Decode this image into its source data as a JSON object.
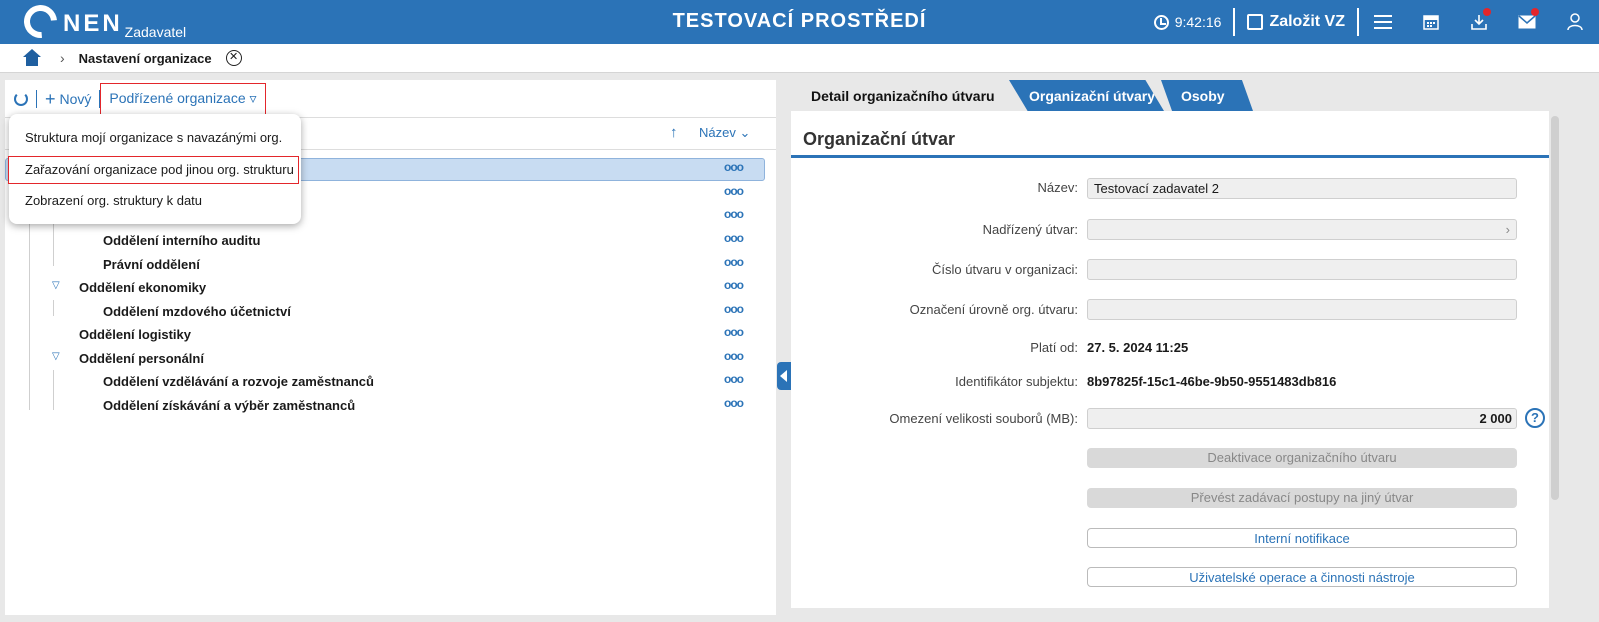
{
  "topbar": {
    "logo_text": "NEN",
    "logo_sub": "Zadavatel",
    "env_title": "TESTOVACÍ PROSTŘEDÍ",
    "time": "9:42:16",
    "create_label": "Založit VZ"
  },
  "breadcrumb": {
    "current": "Nastavení organizace",
    "close_glyph": "✕"
  },
  "left_toolbar": {
    "new_label": "Nový",
    "sub_orgs_label": "Podřízené organizace ▿"
  },
  "sort": {
    "arrow": "↑",
    "label": "Název ⌄"
  },
  "dropdown": {
    "items": [
      "Struktura mojí organizace s navazánými org.",
      "Zařazování organizace pod jinou org. strukturu",
      "Zobrazení org. struktury k datu"
    ]
  },
  "tree": {
    "more": "ooo",
    "rows": [
      "Oddělení interního auditu",
      "Právní oddělení",
      "Oddělení ekonomiky",
      "Oddělení mzdového účetnictví",
      "Oddělení logistiky",
      "Oddělení personální",
      "Oddělení vzdělávání a rozvoje zaměstnanců",
      "Oddělení získávání a výběr zaměstnanců"
    ]
  },
  "tabs": {
    "detail": "Detail organizačního útvaru",
    "units": "Organizační útvary",
    "persons": "Osoby"
  },
  "detail": {
    "section_title": "Organizační útvar",
    "labels": {
      "name": "Název:",
      "parent": "Nadřízený útvar:",
      "number": "Číslo útvaru v organizaci:",
      "level": "Označení úrovně org. útvaru:",
      "valid_from": "Platí od:",
      "subject_id": "Identifikátor subjektu:",
      "file_limit": "Omezení velikosti souborů (MB):"
    },
    "values": {
      "name": "Testovací zadavatel 2",
      "parent": "",
      "number": "",
      "level": "",
      "valid_from": "27. 5. 2024 11:25",
      "subject_id": "8b97825f-15c1-46be-9b50-9551483db816",
      "file_limit": "2 000"
    },
    "help": "?",
    "buttons": {
      "deactivate": "Deaktivace organizačního útvaru",
      "transfer": "Převést zadávací postupy na jiný útvar",
      "notifications": "Interní notifikace",
      "user_ops": "Uživatelské operace a činnosti nástroje"
    }
  },
  "colors": {
    "brand": "#2b73b7",
    "highlight": "#e3262b",
    "selected_row": "#c8dcf2"
  }
}
